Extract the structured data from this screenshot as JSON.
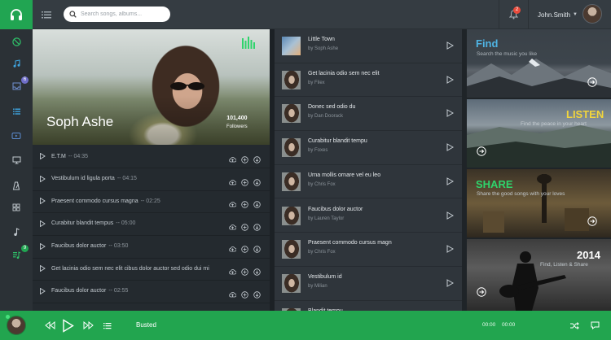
{
  "search": {
    "placeholder": "Search songs, albums..."
  },
  "notifications": {
    "count": "2"
  },
  "user": {
    "name": "John.Smith"
  },
  "sidebar": {
    "items": [
      {
        "icon": "disc-icon"
      },
      {
        "icon": "music-note-icon"
      },
      {
        "icon": "inbox-icon",
        "badge": "6",
        "badge_color": "#6f6ec9"
      },
      {
        "icon": "list-icon"
      },
      {
        "icon": "video-icon"
      },
      {
        "icon": "monitor-icon"
      },
      {
        "icon": "metronome-icon"
      },
      {
        "icon": "grid-icon"
      },
      {
        "icon": "single-note-icon"
      },
      {
        "icon": "playlist-music-icon",
        "badge": "9",
        "badge_color": "#21a552"
      }
    ]
  },
  "artist": {
    "name": "Soph Ashe",
    "followers_count": "101,400",
    "followers_label": "Followers"
  },
  "tracks": [
    {
      "title": "E.T.M",
      "duration": "-- 04:35"
    },
    {
      "title": "Vestibulum id ligula porta",
      "duration": "-- 04:15"
    },
    {
      "title": "Praesent commodo cursus magna",
      "duration": "-- 02:25"
    },
    {
      "title": "Curabitur blandit tempus",
      "duration": "-- 05:00"
    },
    {
      "title": "Faucibus dolor auctor",
      "duration": "-- 03:50"
    },
    {
      "title": "Get lacinia odio sem nec elit cibus dolor auctor sed odio dui mi",
      "duration": ""
    },
    {
      "title": "Faucibus dolor auctor",
      "duration": "-- 02:55"
    }
  ],
  "playlist": [
    {
      "title": "Little Town",
      "artist": "by Soph Ashe"
    },
    {
      "title": "Get lacinia odio sem nec elit",
      "artist": "by Filex"
    },
    {
      "title": "Donec sed odio du",
      "artist": "by Dan Doorack"
    },
    {
      "title": "Curabitur blandit tempu",
      "artist": "by Foxes"
    },
    {
      "title": "Urna mollis ornare vel eu leo",
      "artist": "by Chris Fox"
    },
    {
      "title": "Faucibus dolor auctor",
      "artist": "by Lauren Taylor"
    },
    {
      "title": "Praesent commodo cursus magn",
      "artist": "by Chris Fox"
    },
    {
      "title": "Vestibulum id",
      "artist": "by Milian"
    },
    {
      "title": "Blandit tempu",
      "artist": ""
    }
  ],
  "features": [
    {
      "title": "Find",
      "subtitle": "Search the music you like",
      "color": "#4fb3e2"
    },
    {
      "title": "LISTEN",
      "subtitle": "Find the peace in your heart",
      "color": "#f2d53c"
    },
    {
      "title": "SHARE",
      "subtitle": "Share the good songs with your loves",
      "color": "#2fd46c"
    },
    {
      "title": "2014",
      "subtitle": "Find, Listen & Share",
      "color": "#ffffff"
    }
  ],
  "player": {
    "now_playing": "Busted",
    "elapsed": "00:00",
    "total": "00:00"
  },
  "colors": {
    "brand_green": "#21a552",
    "badge_red": "#e84b3c"
  }
}
